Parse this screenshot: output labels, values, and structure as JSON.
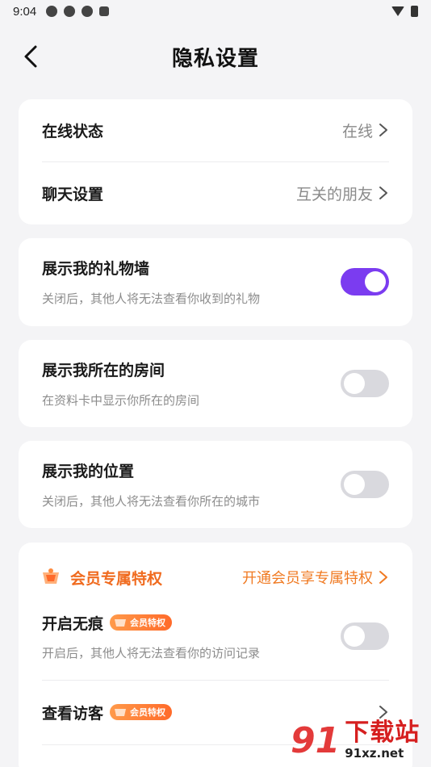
{
  "status_bar": {
    "time": "9:04",
    "icons": [
      "app-notification-icon",
      "app-notification-icon",
      "app-notification-icon",
      "a-notification-icon"
    ],
    "right_icons": [
      "wifi-icon",
      "battery-icon"
    ]
  },
  "header": {
    "title": "隐私设置",
    "back_icon": "back-arrow-icon"
  },
  "settings": {
    "online_status": {
      "label": "在线状态",
      "value": "在线"
    },
    "chat_settings": {
      "label": "聊天设置",
      "value": "互关的朋友"
    },
    "gift_wall": {
      "label": "展示我的礼物墙",
      "desc": "关闭后，其他人将无法查看你收到的礼物",
      "enabled": true
    },
    "show_room": {
      "label": "展示我所在的房间",
      "desc": "在资料卡中显示你所在的房间",
      "enabled": false
    },
    "show_location": {
      "label": "展示我的位置",
      "desc": "关闭后，其他人将无法查看你所在的城市",
      "enabled": false
    }
  },
  "vip": {
    "title": "会员专属特权",
    "link": "开通会员享专属特权",
    "badge": "会员特权",
    "incognito": {
      "label": "开启无痕",
      "desc": "开启后，其他人将无法查看你的访问记录",
      "enabled": false
    },
    "visitors": {
      "label": "查看访客"
    }
  },
  "colors": {
    "accent": "#7b3cf0",
    "vip_orange": "#f06b1f",
    "background": "#f4f4f6"
  },
  "watermark": {
    "logo": "91",
    "text": "下载站",
    "url": "91xz.net"
  }
}
